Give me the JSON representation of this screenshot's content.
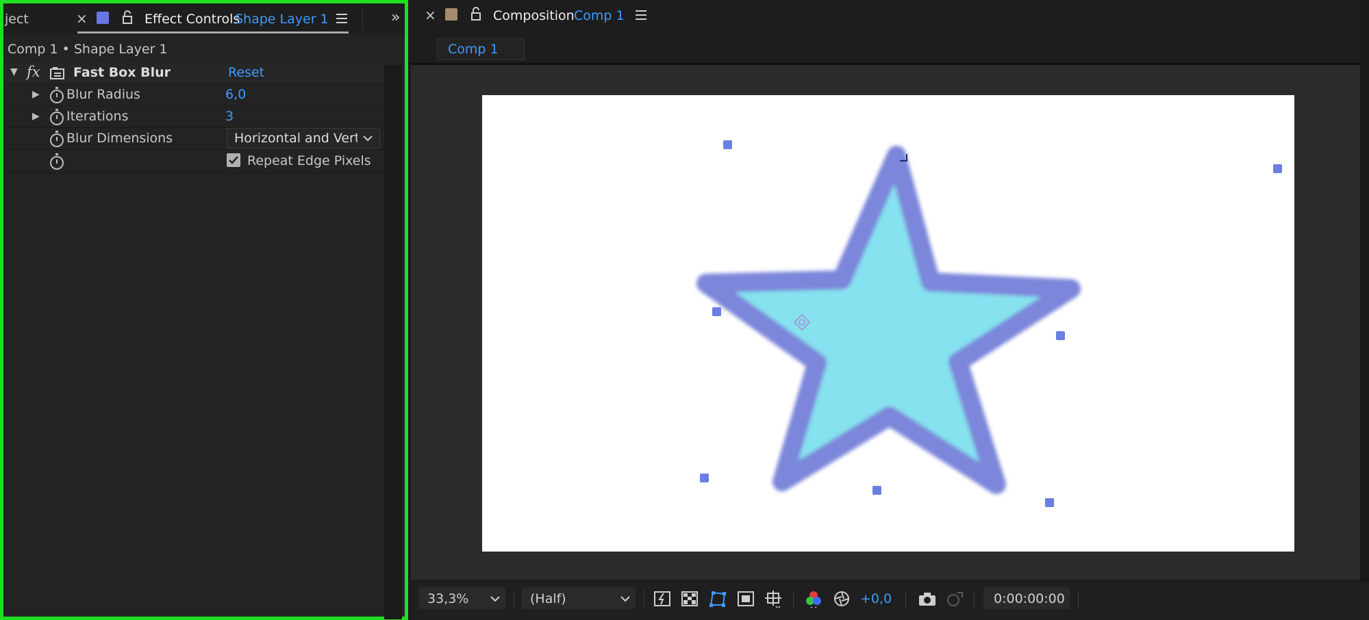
{
  "effect_controls": {
    "partial_tab_label": "ject",
    "tab_title": "Effect Controls",
    "tab_layer": "Shape Layer 1",
    "breadcrumb": "Comp 1 • Shape Layer 1",
    "effect": {
      "fx_label": "fx",
      "name": "Fast Box Blur",
      "reset_label": "Reset"
    },
    "properties": [
      {
        "label": "Blur Radius",
        "value": "6,0"
      },
      {
        "label": "Iterations",
        "value": "3"
      },
      {
        "label": "Blur Dimensions",
        "value": "Horizontal and Verti"
      }
    ],
    "repeat_edge": {
      "label": "Repeat Edge Pixels",
      "checked": true
    }
  },
  "composition": {
    "tab_title": "Composition",
    "tab_comp": "Comp 1",
    "flow_tab": "Comp 1"
  },
  "viewer_controls": {
    "zoom": "33,3%",
    "resolution": "(Half)",
    "exposure": "+0,0",
    "timecode": "0:00:00:00"
  },
  "colors": {
    "accent": "#3d9bff",
    "panel_highlight": "#1ee01e",
    "star_fill": "#86e2ef",
    "star_stroke": "#7b86da"
  }
}
